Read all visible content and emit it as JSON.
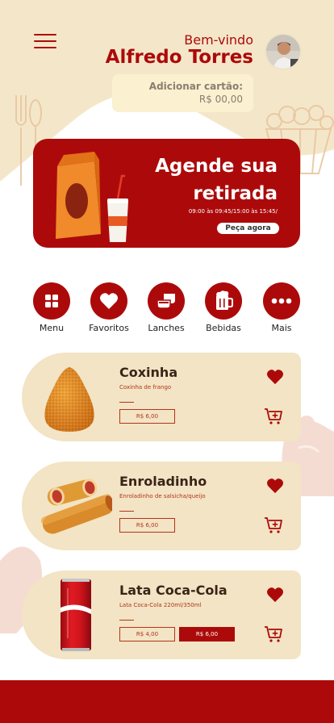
{
  "header": {
    "greeting": "Bem-vindo",
    "user_name": "Alfredo Torres",
    "card_label": "Adicionar cartão:",
    "card_balance": "R$ 00,00"
  },
  "banner": {
    "title_line1": "Agende sua",
    "title_line2": "retirada",
    "times": "09:00 às 09:45/15:00 às 15:45/",
    "cta": "Peça agora"
  },
  "categories": [
    {
      "label": "Menu",
      "icon": "grid-icon"
    },
    {
      "label": "Favoritos",
      "icon": "heart-icon"
    },
    {
      "label": "Lanches",
      "icon": "bowls-icon"
    },
    {
      "label": "Bebidas",
      "icon": "beer-mug-icon"
    },
    {
      "label": "Mais",
      "icon": "more-dots-icon"
    }
  ],
  "products": [
    {
      "name": "Coxinha",
      "description": "Coxinha de frango",
      "prices": [
        "R$ 6,00"
      ]
    },
    {
      "name": "Enroladinho",
      "description": "Enroladinho de salsicha/queijo",
      "prices": [
        "R$ 6,00"
      ]
    },
    {
      "name": "Lata Coca-Cola",
      "description": "Lata Coca-Cola 220ml/350ml",
      "prices": [
        "R$ 4,00",
        "R$ 6,00"
      ]
    }
  ],
  "colors": {
    "brand_red": "#ac0a0a",
    "cream": "#f2e4c4",
    "card_cream": "#fbf0cf"
  }
}
